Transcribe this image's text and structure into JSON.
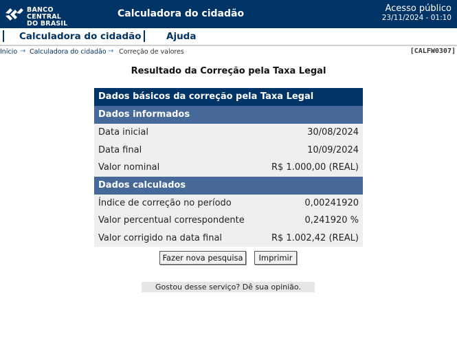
{
  "header": {
    "logo_text_1": "BANCO CENTRAL",
    "logo_text_2": "DO BRASIL",
    "app_title": "Calculadora do cidadão",
    "access_label": "Acesso público",
    "access_datetime": "23/11/2024 - 01:10"
  },
  "menu": {
    "items": [
      {
        "label": "Calculadora do cidadão"
      },
      {
        "label": "Ajuda"
      }
    ]
  },
  "breadcrumb": {
    "items": [
      {
        "label": "Início"
      },
      {
        "label": "Calculadora do cidadão"
      },
      {
        "label": "Correção de valores"
      }
    ],
    "code": "[CALFW0307]"
  },
  "page_title": "Resultado da Correção pela Taxa Legal",
  "result": {
    "header": "Dados básicos da correção pela Taxa Legal",
    "informed": {
      "title": "Dados informados",
      "rows": [
        {
          "label": "Data inicial",
          "value": "30/08/2024"
        },
        {
          "label": "Data final",
          "value": "10/09/2024"
        },
        {
          "label": "Valor nominal",
          "value": "R$ 1.000,00 (REAL)"
        }
      ]
    },
    "calculated": {
      "title": "Dados calculados",
      "rows": [
        {
          "label": "Índice de correção no período",
          "value": "0,00241920"
        },
        {
          "label": "Valor percentual correspondente",
          "value": "0,241920 %"
        },
        {
          "label": "Valor corrigido na data final",
          "value": "R$ 1.002,42 (REAL)"
        }
      ]
    }
  },
  "actions": {
    "new_search": "Fazer nova pesquisa",
    "print": "Imprimir"
  },
  "feedback": "Gostou desse serviço? Dê sua opinião.",
  "colors": {
    "brand_navy": "#003366",
    "section_blue": "#46699a",
    "row_bg": "#efefef"
  }
}
